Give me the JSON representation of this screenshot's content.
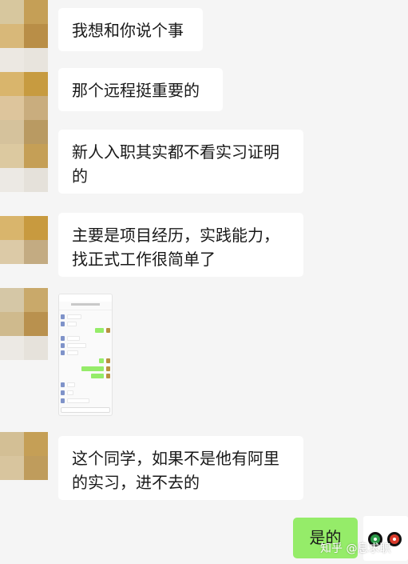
{
  "messages": [
    {
      "sender": "other",
      "text": "我想和你说个事"
    },
    {
      "sender": "other",
      "text": "那个远程挺重要的"
    },
    {
      "sender": "other",
      "text": "新人入职其实都不看实习证明的"
    },
    {
      "sender": "other",
      "text": "主要是项目经历，实践能力，找正式工作很简单了"
    },
    {
      "sender": "other",
      "type": "image",
      "description": "chat screenshot"
    },
    {
      "sender": "other",
      "text": "这个同学，如果不是他有阿里的实习，进不去的"
    },
    {
      "sender": "me",
      "text": "是的"
    }
  ],
  "watermark": "知乎 @息求职",
  "colors": {
    "background": "#f5f5f5",
    "bubble_other": "#ffffff",
    "bubble_me": "#95ec69",
    "avatar_tones": [
      "#d9c48f",
      "#c8a553",
      "#e6dccb",
      "#cbb88e",
      "#b89a62",
      "#ece8e0"
    ]
  }
}
